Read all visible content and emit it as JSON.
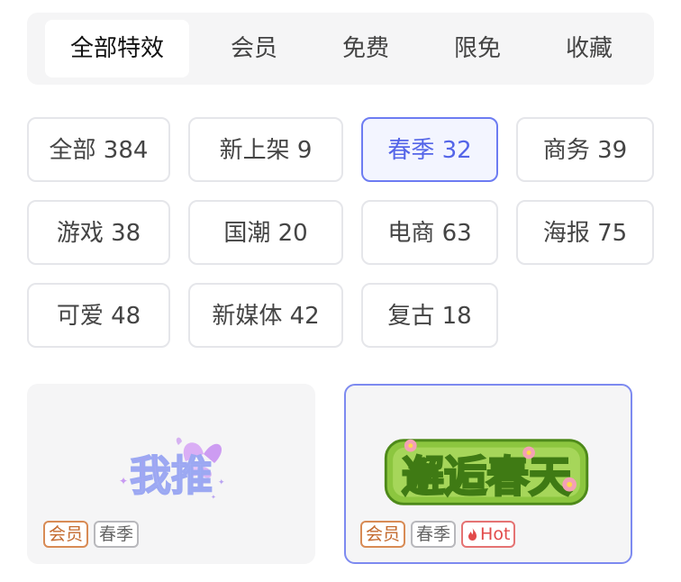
{
  "tabs": [
    {
      "label": "全部特效",
      "active": true
    },
    {
      "label": "会员",
      "active": false
    },
    {
      "label": "免费",
      "active": false
    },
    {
      "label": "限免",
      "active": false
    },
    {
      "label": "收藏",
      "active": false
    }
  ],
  "categories": [
    {
      "label": "全部 384",
      "active": false
    },
    {
      "label": "新上架 9",
      "active": false
    },
    {
      "label": "春季 32",
      "active": true
    },
    {
      "label": "商务 39",
      "active": false
    },
    {
      "label": "游戏 38",
      "active": false
    },
    {
      "label": "国潮 20",
      "active": false
    },
    {
      "label": "电商 63",
      "active": false
    },
    {
      "label": "海报 75",
      "active": false
    },
    {
      "label": "可爱 48",
      "active": false
    },
    {
      "label": "新媒体 42",
      "active": false
    },
    {
      "label": "复古 18",
      "active": false
    }
  ],
  "cards": [
    {
      "preview_text": "我推",
      "tags": [
        "会员",
        "春季"
      ],
      "selected": false
    },
    {
      "preview_text": "邂逅春天",
      "tags": [
        "会员",
        "春季",
        "Hot"
      ],
      "selected": true
    }
  ],
  "colors": {
    "accent": "#5465e8",
    "vip": "#c46a2e",
    "hot": "#e24a4a"
  }
}
